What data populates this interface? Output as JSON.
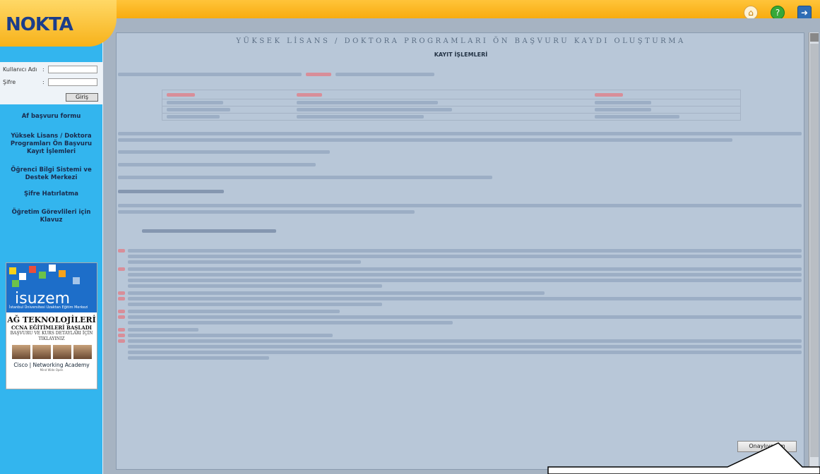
{
  "logo": {
    "text": "NOKTA"
  },
  "login": {
    "username_label": "Kullanıcı Adı",
    "password_label": "Şifre",
    "separator": ":",
    "submit_label": "Giriş"
  },
  "sidebar": {
    "items": [
      {
        "label": "Af başvuru formu"
      },
      {
        "label": "Yüksek Lisans / Doktora Programları Ön Başvuru Kayıt İşlemleri"
      },
      {
        "label": "Öğrenci Bilgi Sistemi ve Destek Merkezi"
      },
      {
        "label": "Şifre Hatırlatma"
      },
      {
        "label": "Öğretim Görevlileri için Klavuz"
      }
    ]
  },
  "ad": {
    "brand": "isuzem",
    "brand_sub": "İstanbul Üniversitesi Uzaktan Eğitim Merkezi",
    "headline": "AĞ TEKNOLOJİLERİ",
    "subheadline": "CCNA EĞİTİMLERİ BAŞLADI",
    "cta": "BAŞVURU VE KURS DETAYLARI İÇİN TIKLAYINIZ",
    "partner": "Cisco | Networking Academy",
    "partner_sub": "Mind Wide Open"
  },
  "topbar": {
    "icons": [
      "home-icon",
      "help-icon",
      "exit-icon"
    ]
  },
  "main": {
    "title": "YÜKSEK LİSANS / DOKTORA PROGRAMLARI ÖN BAŞVURU KAYDI OLUŞTURMA",
    "subtitle": "KAYIT İŞLEMLERİ",
    "confirm_label": "Onaylıyorum"
  },
  "colors": {
    "accent": "#f6a300",
    "sidebar": "#33b5ee",
    "panel": "#b8c7d8"
  }
}
